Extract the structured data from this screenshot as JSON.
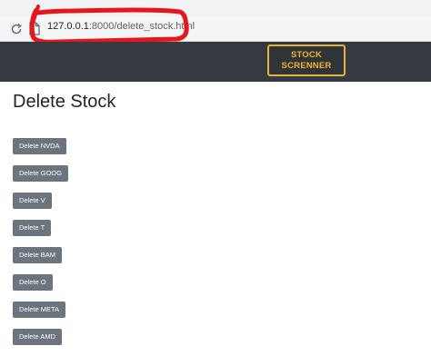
{
  "browser": {
    "url_host": "127.0.0.1",
    "url_path": ":8000/delete_stock.html",
    "reload_icon": "reload-icon",
    "page_icon": "page-icon"
  },
  "navbar": {
    "brand_line1": "STOCK",
    "brand_line2": "SCRENNER",
    "brand_color": "#f0b429",
    "background": "#343a40"
  },
  "page": {
    "title": "Delete Stock"
  },
  "buttons": [
    {
      "label": "Delete NVDA"
    },
    {
      "label": "Delete GOOG"
    },
    {
      "label": "Delete V"
    },
    {
      "label": "Delete T"
    },
    {
      "label": "Delete BAM"
    },
    {
      "label": "Delete O"
    },
    {
      "label": "Delete META"
    },
    {
      "label": "Delete AMD"
    }
  ],
  "colors": {
    "button_bg": "#6c757d",
    "annotation": "#e8151b"
  }
}
